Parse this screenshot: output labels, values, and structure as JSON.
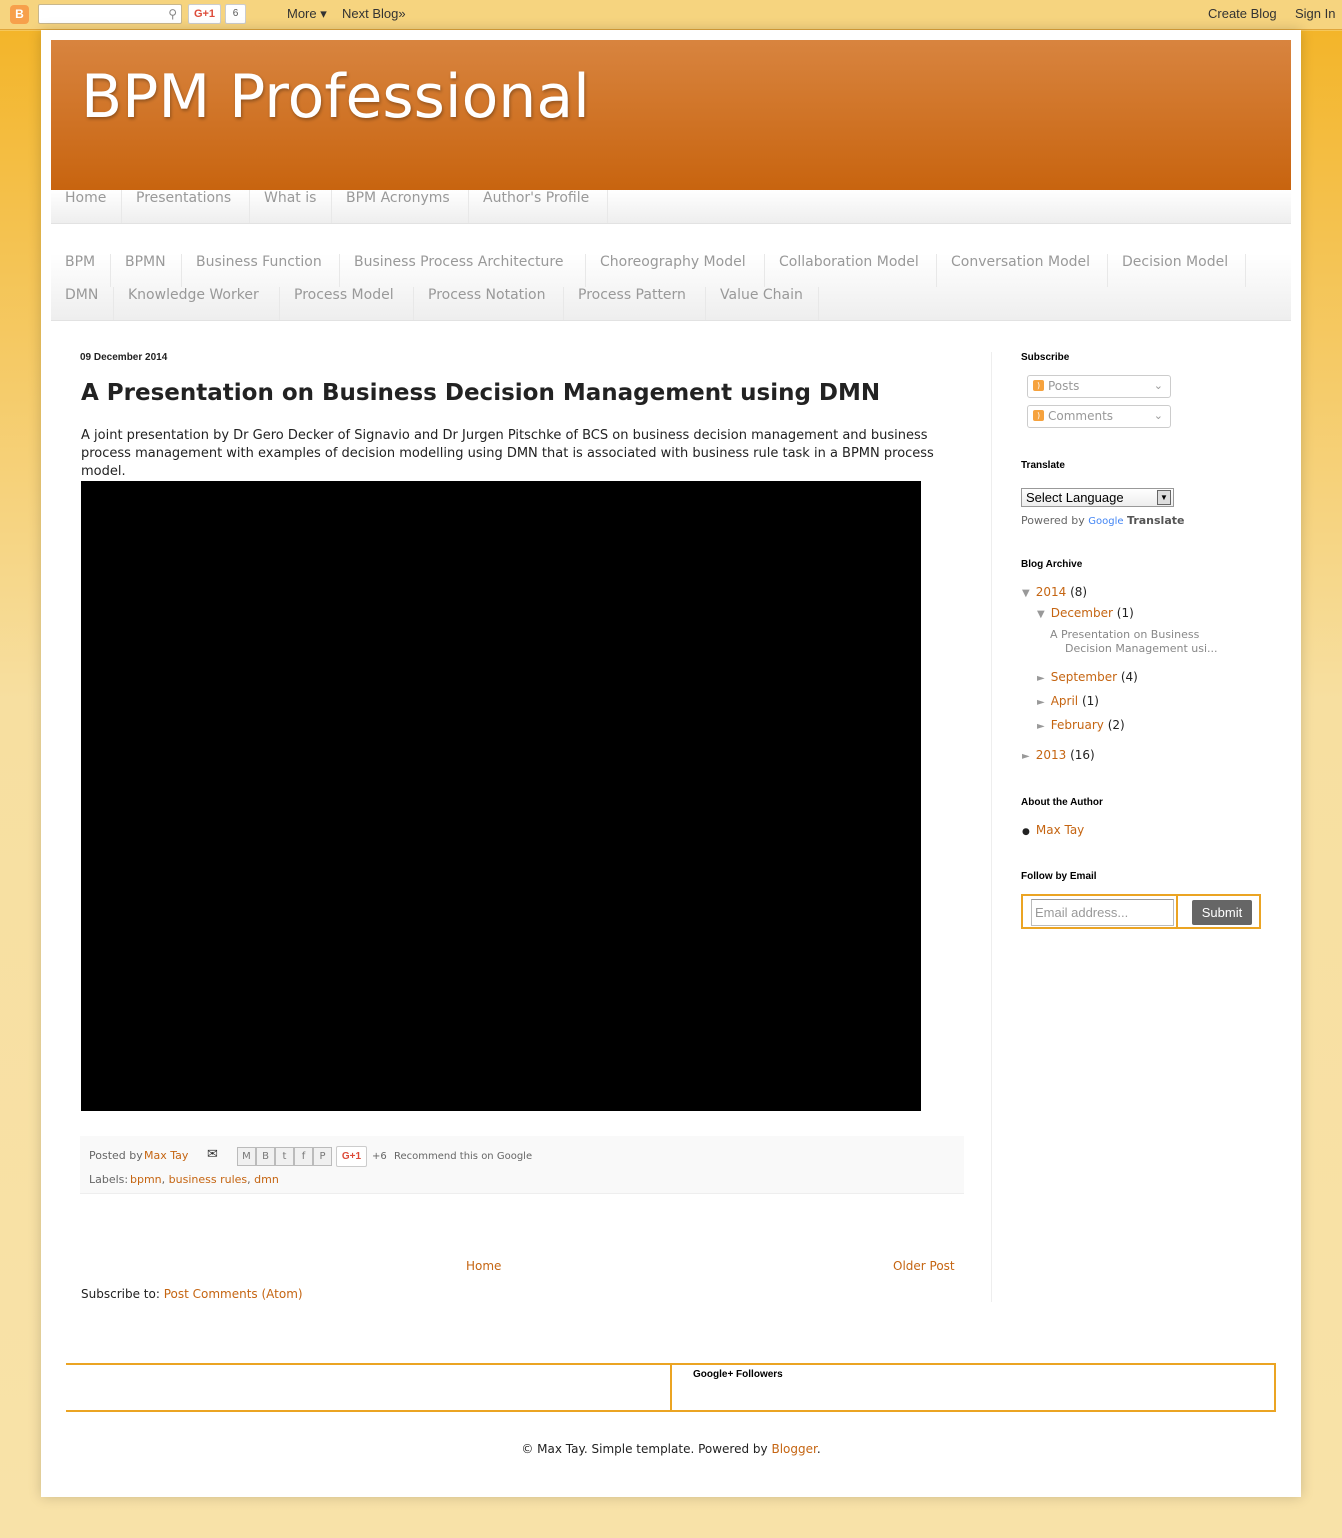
{
  "navbar": {
    "logo": "B",
    "search_placeholder": "",
    "gplus_label": "G+1",
    "gplus_count": "6",
    "more_label": "More ▾",
    "next_blog_label": "Next Blog»",
    "create_blog_label": "Create Blog",
    "sign_in_label": "Sign In"
  },
  "header": {
    "title": "BPM Professional"
  },
  "pages_tabs": [
    "Home",
    "Presentations",
    "What is",
    "BPM Acronyms",
    "Author's Profile"
  ],
  "label_tabs": [
    "BPM",
    "BPMN",
    "Business Function",
    "Business Process Architecture",
    "Choreography Model",
    "Collaboration Model",
    "Conversation Model",
    "Decision Model",
    "DMN",
    "Knowledge Worker",
    "Process Model",
    "Process Notation",
    "Process Pattern",
    "Value Chain"
  ],
  "post": {
    "date": "09 December 2014",
    "title": "A Presentation on Business Decision Management using DMN",
    "body": "A joint presentation by Dr Gero Decker of Signavio and Dr Jurgen Pitschke of BCS on business decision management and business process management with examples of decision modelling using DMN that is associated with business rule task in a BPMN process model.",
    "posted_by_prefix": "Posted by",
    "author": "Max Tay",
    "share_icons": [
      "email-icon",
      "blogthis-icon",
      "twitter-icon",
      "facebook-icon",
      "pinterest-icon"
    ],
    "gplus_label": "G+1",
    "gplus_count": "+6",
    "recommend_text": "Recommend this on Google",
    "labels_prefix": "Labels:",
    "labels": [
      "bpmn",
      "business rules",
      "dmn"
    ]
  },
  "pager": {
    "home": "Home",
    "older": "Older Post"
  },
  "feed": {
    "prefix": "Subscribe to:",
    "link": "Post Comments (Atom)"
  },
  "sidebar": {
    "subscribe_title": "Subscribe",
    "feeds": [
      "Posts",
      "Comments"
    ],
    "translate_title": "Translate",
    "language_select": "Select Language",
    "powered_by": "Powered by",
    "google": "Google",
    "translate": "Translate",
    "archive_title": "Blog Archive",
    "archive": {
      "y2014": {
        "label": "2014",
        "count": "(8)"
      },
      "december": {
        "label": "December",
        "count": "(1)"
      },
      "december_post_line1": "A Presentation on Business",
      "december_post_line2": "Decision Management usi...",
      "september": {
        "label": "September",
        "count": "(4)"
      },
      "april": {
        "label": "April",
        "count": "(1)"
      },
      "february": {
        "label": "February",
        "count": "(2)"
      },
      "y2013": {
        "label": "2013",
        "count": "(16)"
      }
    },
    "about_title": "About the Author",
    "about_author": "Max Tay",
    "follow_title": "Follow by Email",
    "email_placeholder": "Email address...",
    "submit_label": "Submit"
  },
  "footer": {
    "gplus_followers_title": "Google+ Followers",
    "attribution_prefix": "© Max Tay. Simple template. Powered by",
    "blogger_link": "Blogger",
    "attribution_suffix": "."
  },
  "colors": {
    "link": "#c56512",
    "header_gradient_top": "#d8843f",
    "header_gradient_bottom": "#c8640f",
    "accent_border": "#eba423"
  }
}
